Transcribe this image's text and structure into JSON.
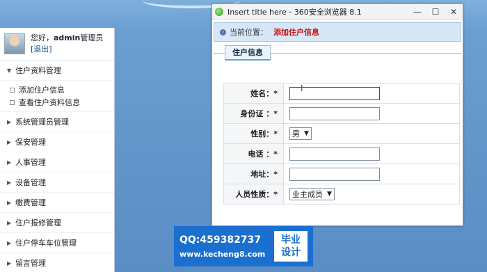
{
  "user": {
    "greeting": "您好，",
    "name": "admin",
    "role": "管理员",
    "logout": "[退出]"
  },
  "sidebar": {
    "expanded_group": "住户资料管理",
    "sub_items": [
      "添加住户信息",
      "查看住户资料信息"
    ],
    "groups": [
      "系统管理员管理",
      "保安管理",
      "人事管理",
      "设备管理",
      "缴费管理",
      "住户报修管理",
      "住户停车车位管理",
      "留言管理"
    ]
  },
  "popup": {
    "title": "Insert title here - 360安全浏览器 8.1",
    "breadcrumb_label": "当前位置：",
    "breadcrumb_value": "添加住户信息",
    "section_title": "住户信息",
    "fields": {
      "name_label": "姓名：*",
      "id_label": "身份证 ：*",
      "gender_label": "性别：*",
      "gender_value": "男",
      "phone_label": "电话 ：*",
      "address_label": "地址：*",
      "type_label": "人员性质：*",
      "type_value": "业主成员"
    }
  },
  "watermark": {
    "qq": "QQ:459382737",
    "site": "www.kecheng8.com",
    "badge_top": "毕业",
    "badge_bottom": "设计"
  },
  "colors": {
    "accent": "#1b6fce",
    "breadcrumb_value": "#cc1111",
    "background": "#5c8cc0"
  }
}
